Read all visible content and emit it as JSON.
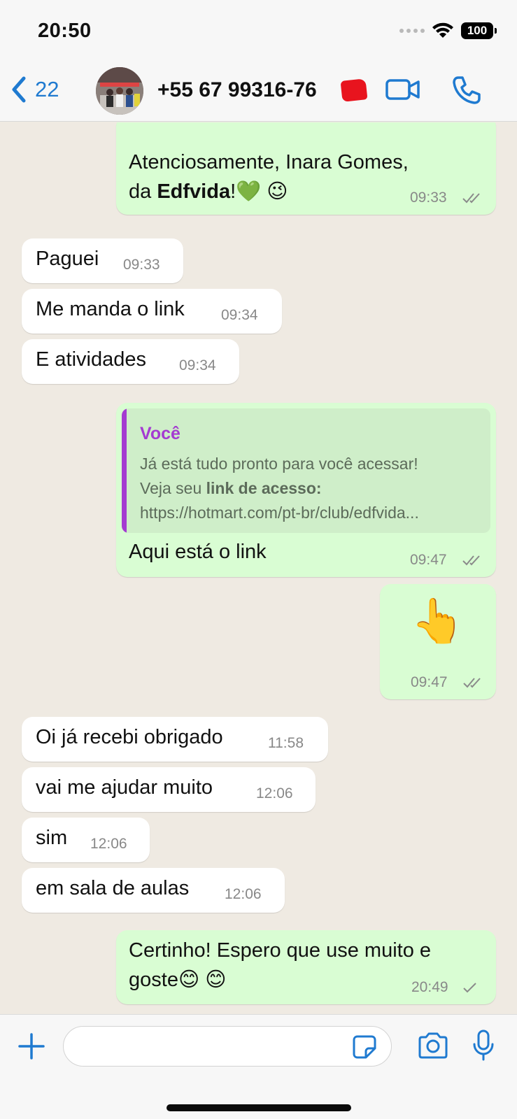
{
  "status_bar": {
    "time": "20:50",
    "battery": "100"
  },
  "header": {
    "back_count": "22",
    "contact_name": "+55 67 99316-76"
  },
  "messages": [
    {
      "direction": "out",
      "lines": [
        "Atenciosamente, Inara Gomes,",
        "da "
      ],
      "bold": "Edfvida",
      "tail": "!💚 😉",
      "time": "09:33",
      "status": "read"
    },
    {
      "direction": "in",
      "text": "Paguei",
      "time": "09:33"
    },
    {
      "direction": "in",
      "text": "Me manda o link",
      "time": "09:34"
    },
    {
      "direction": "in",
      "text": "E atividades",
      "time": "09:34"
    },
    {
      "direction": "out",
      "quote": {
        "author": "Você",
        "line1": "Já está tudo pronto para você acessar!",
        "line2_prefix": "Veja seu ",
        "line2_bold": "link de acesso:",
        "line3": "https://hotmart.com/pt-br/club/edfvida..."
      },
      "text": "Aqui está o link",
      "time": "09:47",
      "status": "read"
    },
    {
      "direction": "out",
      "emoji": "👆",
      "time": "09:47",
      "status": "read"
    },
    {
      "direction": "in",
      "text": "Oi já recebi obrigado",
      "time": "11:58"
    },
    {
      "direction": "in",
      "text": "vai me ajudar muito",
      "time": "12:06"
    },
    {
      "direction": "in",
      "text": "sim",
      "time": "12:06"
    },
    {
      "direction": "in",
      "text": "em sala de aulas",
      "time": "12:06"
    },
    {
      "direction": "out",
      "lines": [
        "Certinho! Espero que use muito e",
        "goste😊 😊"
      ],
      "time": "20:49",
      "status": "sent"
    }
  ],
  "input_bar": {
    "placeholder": ""
  },
  "colors": {
    "accent": "#1f7ad0",
    "incoming_bubble": "#ffffff",
    "outgoing_bubble": "#d9fdd3",
    "chat_background": "#efeae2",
    "quote_author": "#a43bd1"
  },
  "icons": [
    "back-chevron-icon",
    "video-call-icon",
    "phone-call-icon",
    "plus-icon",
    "sticker-icon",
    "camera-icon",
    "microphone-icon",
    "wifi-icon",
    "double-check-icon",
    "single-check-icon"
  ]
}
